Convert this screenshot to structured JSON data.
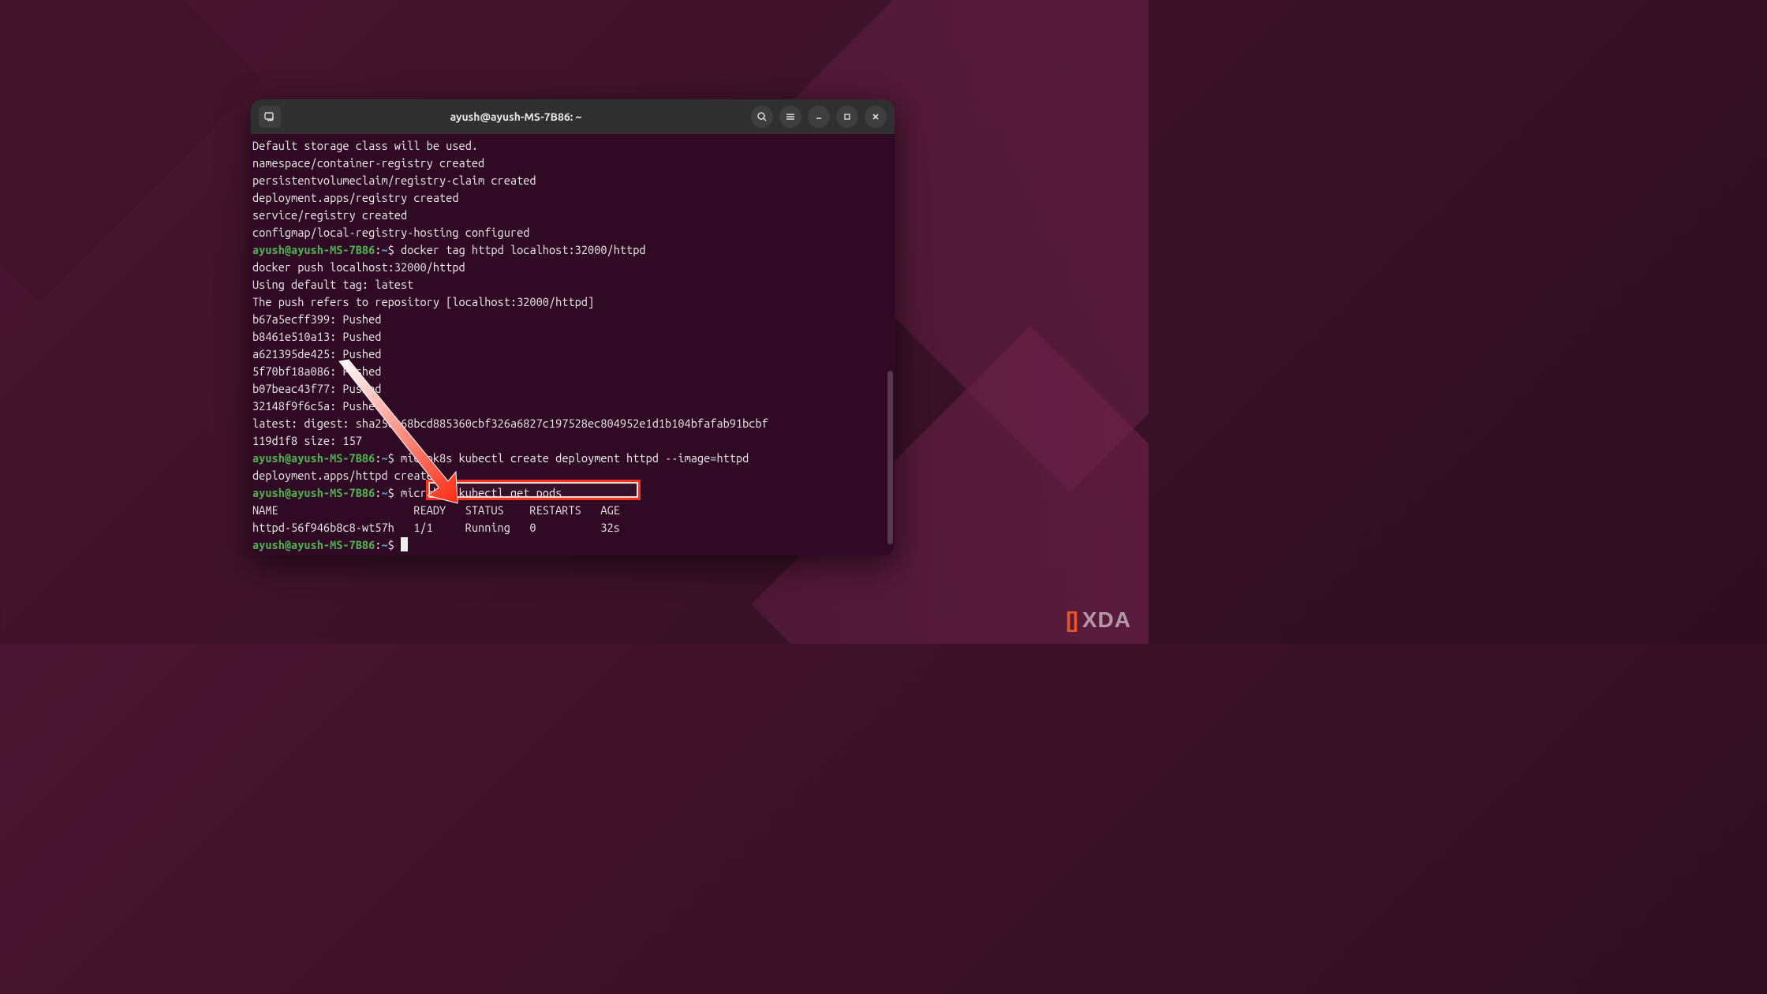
{
  "window": {
    "title": "ayush@ayush-MS-7B86: ~"
  },
  "prompt": {
    "user_host": "ayush@ayush-MS-7B86",
    "sep": ":",
    "path": "~",
    "dollar": "$"
  },
  "output": {
    "pre1": "Default storage class will be used.",
    "pre2": "namespace/container-registry created",
    "pre3": "persistentvolumeclaim/registry-claim created",
    "pre4": "deployment.apps/registry created",
    "pre5": "service/registry created",
    "pre6": "configmap/local-registry-hosting configured",
    "cmd1": " docker tag httpd localhost:32000/httpd",
    "line8": "docker push localhost:32000/httpd",
    "line9": "Using default tag: latest",
    "line10": "The push refers to repository [localhost:32000/httpd]",
    "line11": "b67a5ecff399: Pushed",
    "line12": "b8461e510a13: Pushed",
    "line13": "a621395de425: Pushed",
    "line14": "5f70bf18a086: Pushed",
    "line15": "b07beac43f77: Pushed",
    "line16": "32148f9f6c5a: Pushed",
    "line17": "latest: digest: sha256:68bcd885360cbf326a6827c197528ec804952e1d1b104bfafab91bcbf",
    "line18": "119d1f8 size: 157",
    "cmd2": " microk8s kubectl create deployment httpd --image=httpd",
    "line20": "deployment.apps/httpd created",
    "cmd3": " microk8s kubectl get pods ",
    "table_header": "NAME                     READY   STATUS    RESTARTS   AGE",
    "table_row": "httpd-56f946b8c8-wt57h   1/1     Running   0          32s"
  },
  "annotation": {
    "highlighted_command": "microk8s kubectl get pods"
  },
  "watermark": {
    "text": "XDA"
  }
}
